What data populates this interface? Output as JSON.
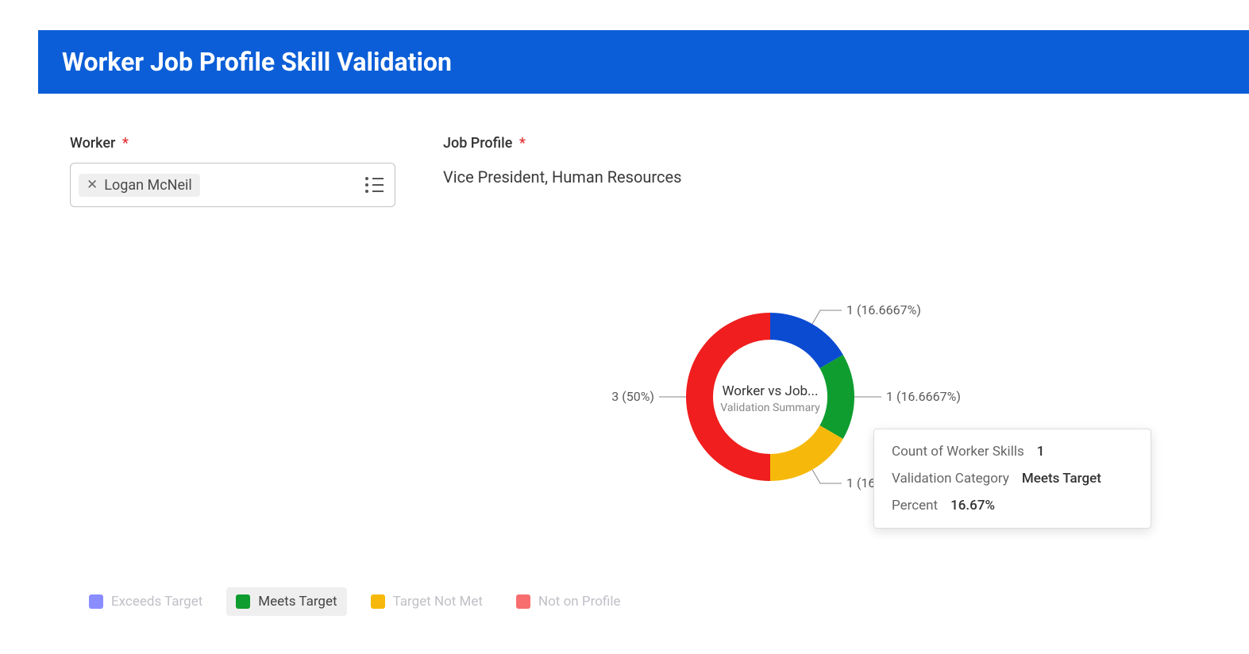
{
  "header": {
    "title": "Worker Job Profile Skill Validation"
  },
  "form": {
    "worker_label": "Worker",
    "worker_value": "Logan McNeil",
    "job_profile_label": "Job Profile",
    "job_profile_value": "Vice President, Human Resources"
  },
  "chart_data": {
    "type": "pie",
    "title": "Worker vs Job...",
    "subtitle": "Validation Summary",
    "categories": [
      "Exceeds Target",
      "Meets Target",
      "Target Not Met",
      "Not on Profile"
    ],
    "values": [
      1,
      1,
      1,
      3
    ],
    "percentages": [
      16.6667,
      16.6667,
      16.6667,
      50
    ],
    "colors": [
      "#0b4bd2",
      "#0f9d2f",
      "#f6b90b",
      "#f01e1e"
    ],
    "labels": {
      "exceeds": "1 (16.6667%)",
      "meets": "1 (16.6667%)",
      "notmet_truncated": "1 (16.",
      "notonprofile": "3 (50%)"
    }
  },
  "tooltip": {
    "rows": [
      {
        "label": "Count of Worker Skills",
        "value": "1"
      },
      {
        "label": "Validation Category",
        "value": "Meets Target"
      },
      {
        "label": "Percent",
        "value": "16.67%"
      }
    ]
  },
  "legend": {
    "items": [
      {
        "label": "Exceeds Target",
        "color": "#8a8dff",
        "state": "dim"
      },
      {
        "label": "Meets Target",
        "color": "#0f9d2f",
        "state": "active"
      },
      {
        "label": "Target Not Met",
        "color": "#f6b90b",
        "state": "dim"
      },
      {
        "label": "Not on Profile",
        "color": "#f86e6e",
        "state": "dim"
      }
    ]
  }
}
